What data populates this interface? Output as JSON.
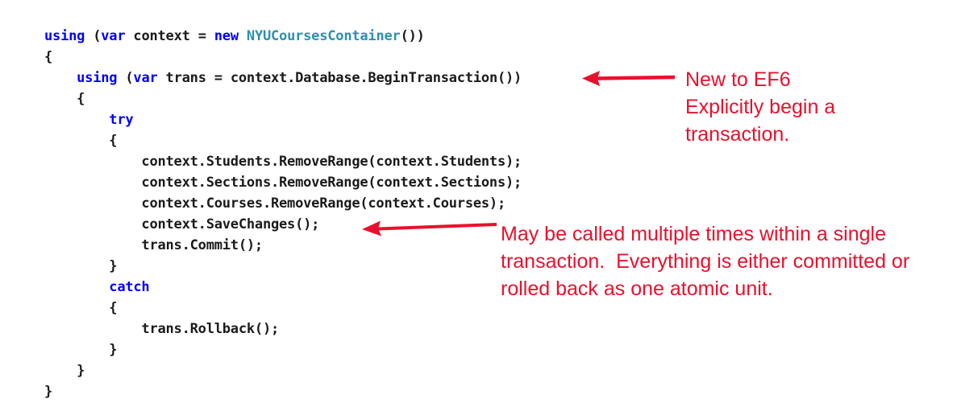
{
  "code": {
    "language": "csharp",
    "colors": {
      "keyword": "#0000FF",
      "type": "#2B91AF",
      "plain": "#1A1A1A",
      "background": "#FFFFFF",
      "annotation": "#E8112D"
    },
    "lines": [
      {
        "indent": 0,
        "tokens": [
          {
            "t": "using ",
            "c": "kw"
          },
          {
            "t": "(",
            "c": "plain"
          },
          {
            "t": "var",
            "c": "kw"
          },
          {
            "t": " context = ",
            "c": "plain"
          },
          {
            "t": "new ",
            "c": "kw"
          },
          {
            "t": "NYUCoursesContainer",
            "c": "type"
          },
          {
            "t": "())",
            "c": "plain"
          }
        ]
      },
      {
        "indent": 0,
        "tokens": [
          {
            "t": "{",
            "c": "plain"
          }
        ]
      },
      {
        "indent": 4,
        "tokens": [
          {
            "t": "using ",
            "c": "kw"
          },
          {
            "t": "(",
            "c": "plain"
          },
          {
            "t": "var",
            "c": "kw"
          },
          {
            "t": " trans = context.Database.BeginTransaction())",
            "c": "plain"
          }
        ]
      },
      {
        "indent": 4,
        "tokens": [
          {
            "t": "{",
            "c": "plain"
          }
        ]
      },
      {
        "indent": 8,
        "tokens": [
          {
            "t": "try",
            "c": "kw"
          }
        ]
      },
      {
        "indent": 8,
        "tokens": [
          {
            "t": "{",
            "c": "plain"
          }
        ]
      },
      {
        "indent": 12,
        "tokens": [
          {
            "t": "context.Students.RemoveRange(context.Students);",
            "c": "plain"
          }
        ]
      },
      {
        "indent": 12,
        "tokens": [
          {
            "t": "context.Sections.RemoveRange(context.Sections);",
            "c": "plain"
          }
        ]
      },
      {
        "indent": 12,
        "tokens": [
          {
            "t": "context.Courses.RemoveRange(context.Courses);",
            "c": "plain"
          }
        ]
      },
      {
        "indent": 12,
        "tokens": [
          {
            "t": "context.SaveChanges();",
            "c": "plain"
          }
        ]
      },
      {
        "indent": 12,
        "tokens": [
          {
            "t": "trans.Commit();",
            "c": "plain"
          }
        ]
      },
      {
        "indent": 8,
        "tokens": [
          {
            "t": "}",
            "c": "plain"
          }
        ]
      },
      {
        "indent": 8,
        "tokens": [
          {
            "t": "catch",
            "c": "kw"
          }
        ]
      },
      {
        "indent": 8,
        "tokens": [
          {
            "t": "{",
            "c": "plain"
          }
        ]
      },
      {
        "indent": 12,
        "tokens": [
          {
            "t": "trans.Rollback();",
            "c": "plain"
          }
        ]
      },
      {
        "indent": 8,
        "tokens": [
          {
            "t": "}",
            "c": "plain"
          }
        ]
      },
      {
        "indent": 4,
        "tokens": [
          {
            "t": "}",
            "c": "plain"
          }
        ]
      },
      {
        "indent": 0,
        "tokens": [
          {
            "t": "}",
            "c": "plain"
          }
        ]
      }
    ]
  },
  "annotations": [
    {
      "id": "annotation-1",
      "lines": [
        "New to EF6",
        "Explicitly begin a",
        "transaction."
      ],
      "text": "New to EF6\nExplicitly begin a\ntransaction."
    },
    {
      "id": "annotation-2",
      "lines": [
        "May be called multiple times within a single",
        "transaction.  Everything is either committed or",
        "rolled back as one atomic unit."
      ],
      "text": "May be called multiple times within a single\ntransaction.  Everything is either committed or\nrolled back as one atomic unit."
    }
  ],
  "arrows": [
    {
      "id": "arrow-1",
      "direction": "left",
      "points_to": "context.Database.BeginTransaction()"
    },
    {
      "id": "arrow-2",
      "direction": "left",
      "points_to": "context.SaveChanges();"
    }
  ]
}
